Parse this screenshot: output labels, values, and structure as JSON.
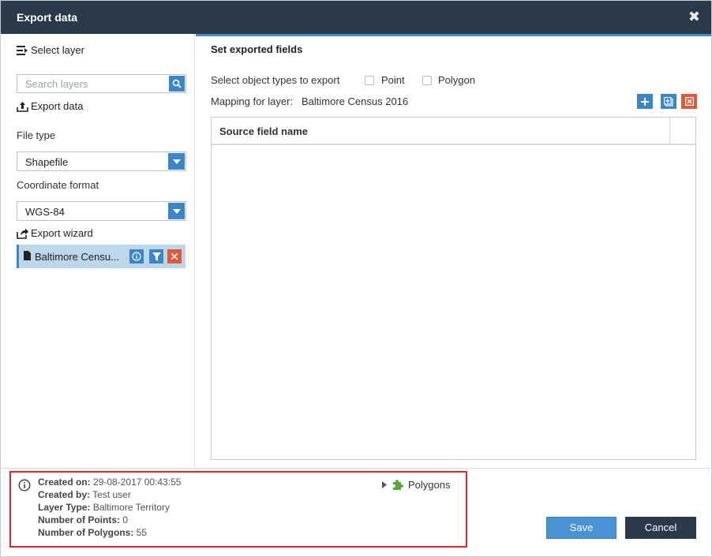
{
  "window": {
    "title": "Export data"
  },
  "sidebar": {
    "select_layer_label": "Select layer",
    "search_placeholder": "Search layers",
    "export_data_label": "Export data",
    "file_type_label": "File type",
    "file_type_value": "Shapefile",
    "coordinate_format_label": "Coordinate format",
    "coordinate_format_value": "WGS-84",
    "export_wizard_label": "Export wizard",
    "layer_item_name": "Baltimore Censu..."
  },
  "main": {
    "section_title": "Set exported fields",
    "object_types_label": "Select object types to export",
    "point_label": "Point",
    "polygon_label": "Polygon",
    "mapping_label": "Mapping for layer:",
    "mapping_layer": "Baltimore Census 2016",
    "table_header": "Source field name"
  },
  "info": {
    "created_on_label": "Created on:",
    "created_on_value": "29-08-2017 00:43:55",
    "created_by_label": "Created by:",
    "created_by_value": "Test user",
    "layer_type_label": "Layer Type:",
    "layer_type_value": "Baltimore Territory",
    "points_label": "Number of Points:",
    "points_value": "0",
    "polygons_label": "Number of Polygons:",
    "polygons_value": "55",
    "tree_label": "Polygons"
  },
  "actions": {
    "save_label": "Save",
    "cancel_label": "Cancel"
  },
  "colors": {
    "titlebar": "#2b3a4a",
    "accent": "#3a86c8",
    "danger": "#e05a3a",
    "highlight_border": "#d42a2a"
  }
}
